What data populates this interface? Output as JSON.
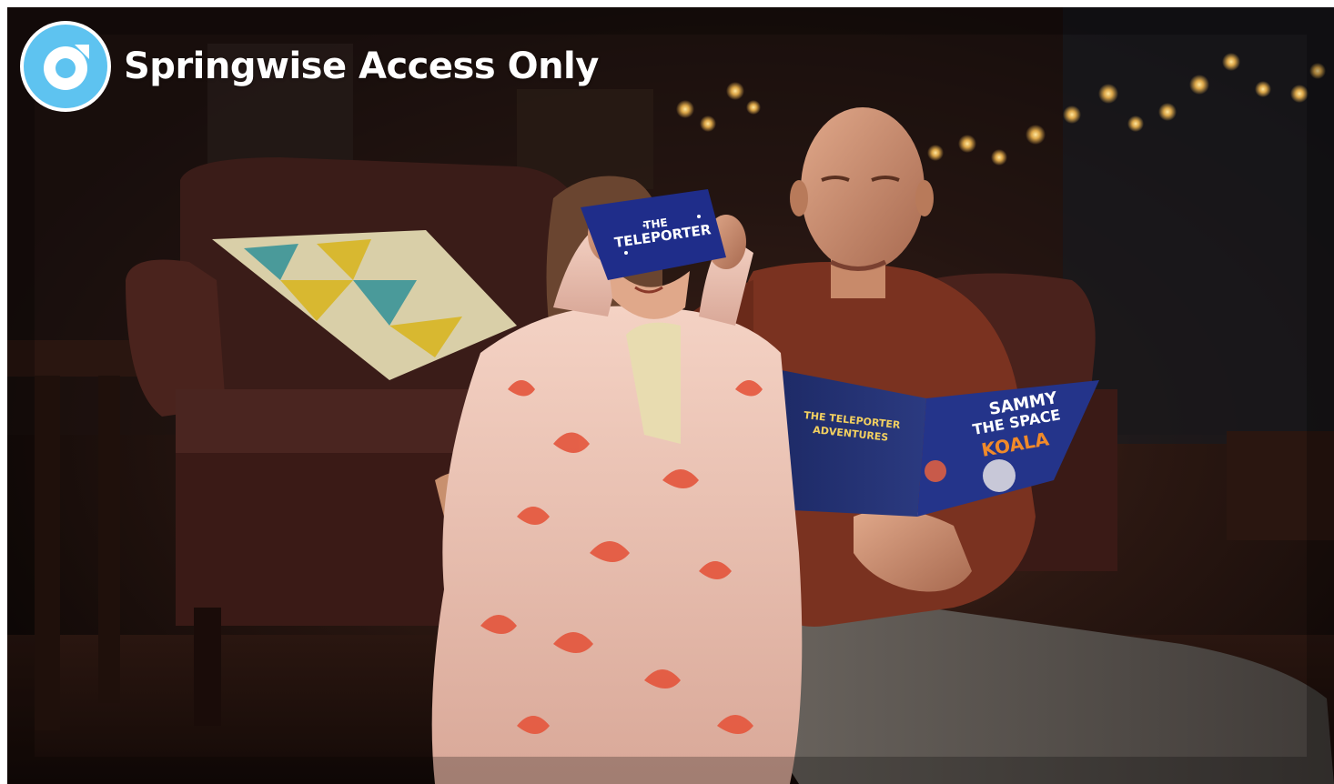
{
  "badge": {
    "label": "Springwise Access Only",
    "icon": "springwise-logo-icon"
  },
  "photo": {
    "vr_viewer_text": [
      "THE",
      "TELEPORTER"
    ],
    "book_left_title": [
      "THE TELEPORTER",
      "ADVENTURES"
    ],
    "book_right_title": [
      "SAMMY",
      "THE SPACE",
      "KOALA"
    ]
  },
  "colors": {
    "badge_circle": "#5ec3f0",
    "badge_ring": "#ffffff",
    "room_dark": "#1a100c",
    "robe": "#f2c6b6",
    "robe_pattern": "#e8503a",
    "shirt": "#8a3a24",
    "book_blue": "#1f2d6b",
    "koala_orange": "#f08a2a"
  }
}
